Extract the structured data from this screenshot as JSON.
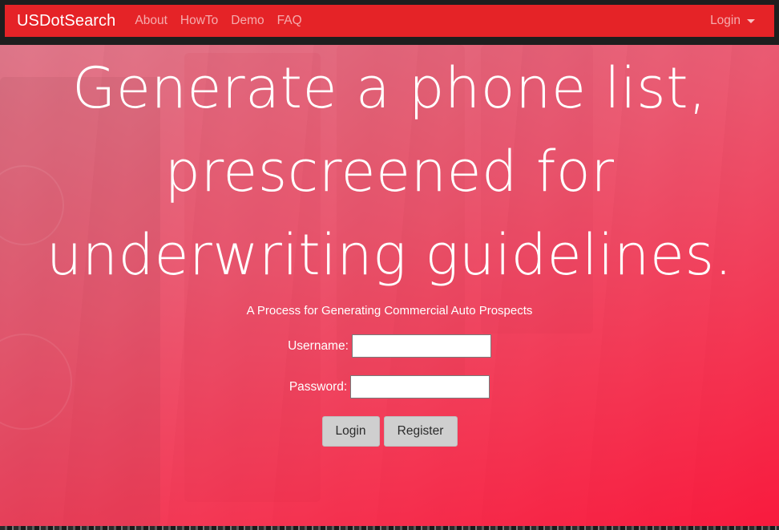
{
  "navbar": {
    "brand": "USDotSearch",
    "links": [
      "About",
      "HowTo",
      "Demo",
      "FAQ"
    ],
    "login_label": "Login"
  },
  "hero": {
    "headline_lines": [
      "Generate a phone list,",
      "prescreened for",
      "underwriting guidelines."
    ],
    "subtitle": "A Process for Generating Commercial Auto Prospects"
  },
  "form": {
    "username_label": "Username:",
    "username_value": "",
    "password_label": "Password:",
    "password_value": "",
    "login_button": "Login",
    "register_button": "Register"
  },
  "colors": {
    "navbar": "#e52327",
    "hero_tint": "#f4365a",
    "button": "#cfcfcf"
  }
}
